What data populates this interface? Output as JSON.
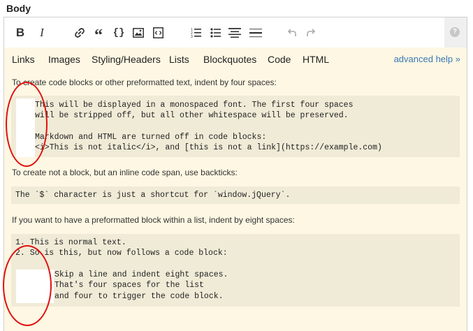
{
  "field_label": "Body",
  "toolbar": {
    "buttons": [
      {
        "name": "bold",
        "icon": "bold-icon"
      },
      {
        "name": "italic",
        "icon": "italic-icon"
      },
      {
        "name": "link",
        "icon": "link-icon"
      },
      {
        "name": "blockquote",
        "icon": "quote-icon"
      },
      {
        "name": "code",
        "icon": "code-braces-icon"
      },
      {
        "name": "image",
        "icon": "image-icon"
      },
      {
        "name": "snippet",
        "icon": "snippet-icon"
      },
      {
        "name": "numbered-list",
        "icon": "numbered-list-icon"
      },
      {
        "name": "bulleted-list",
        "icon": "bulleted-list-icon"
      },
      {
        "name": "heading",
        "icon": "heading-icon"
      },
      {
        "name": "horizontal-rule",
        "icon": "horizontal-rule-icon"
      },
      {
        "name": "undo",
        "icon": "undo-icon"
      },
      {
        "name": "redo",
        "icon": "redo-icon"
      }
    ],
    "help_glyph": "?"
  },
  "tabs": [
    "Links",
    "Images",
    "Styling/Headers",
    "Lists",
    "Blockquotes",
    "Code",
    "HTML"
  ],
  "advanced_help": "advanced help »",
  "content": {
    "intro_1": "To create code blocks or other preformatted text, indent by four spaces:",
    "code_1": [
      "This will be displayed in a monospaced font. The first four spaces",
      "will be stripped off, but all other whitespace will be preserved.",
      "",
      "Markdown and HTML are turned off in code blocks:",
      "<i>This is not italic</i>, and [this is not a link](https://example.com)"
    ],
    "intro_2": "To create not a block, but an inline code span, use backticks:",
    "code_2": "The `$` character is just a shortcut for `window.jQuery`.",
    "intro_3": "If you want to have a preformatted block within a list, indent by eight spaces:",
    "code_3": [
      "1. This is normal text.",
      "2. So is this, but now follows a code block:",
      "",
      "Skip a line and indent eight spaces.",
      "That's four spaces for the list",
      "and four to trigger the code block."
    ]
  },
  "colors": {
    "panel_bg": "#fdf7e3",
    "code_bg": "#f0ebd7",
    "link": "#3a78b5",
    "annotation": "#e01010"
  }
}
